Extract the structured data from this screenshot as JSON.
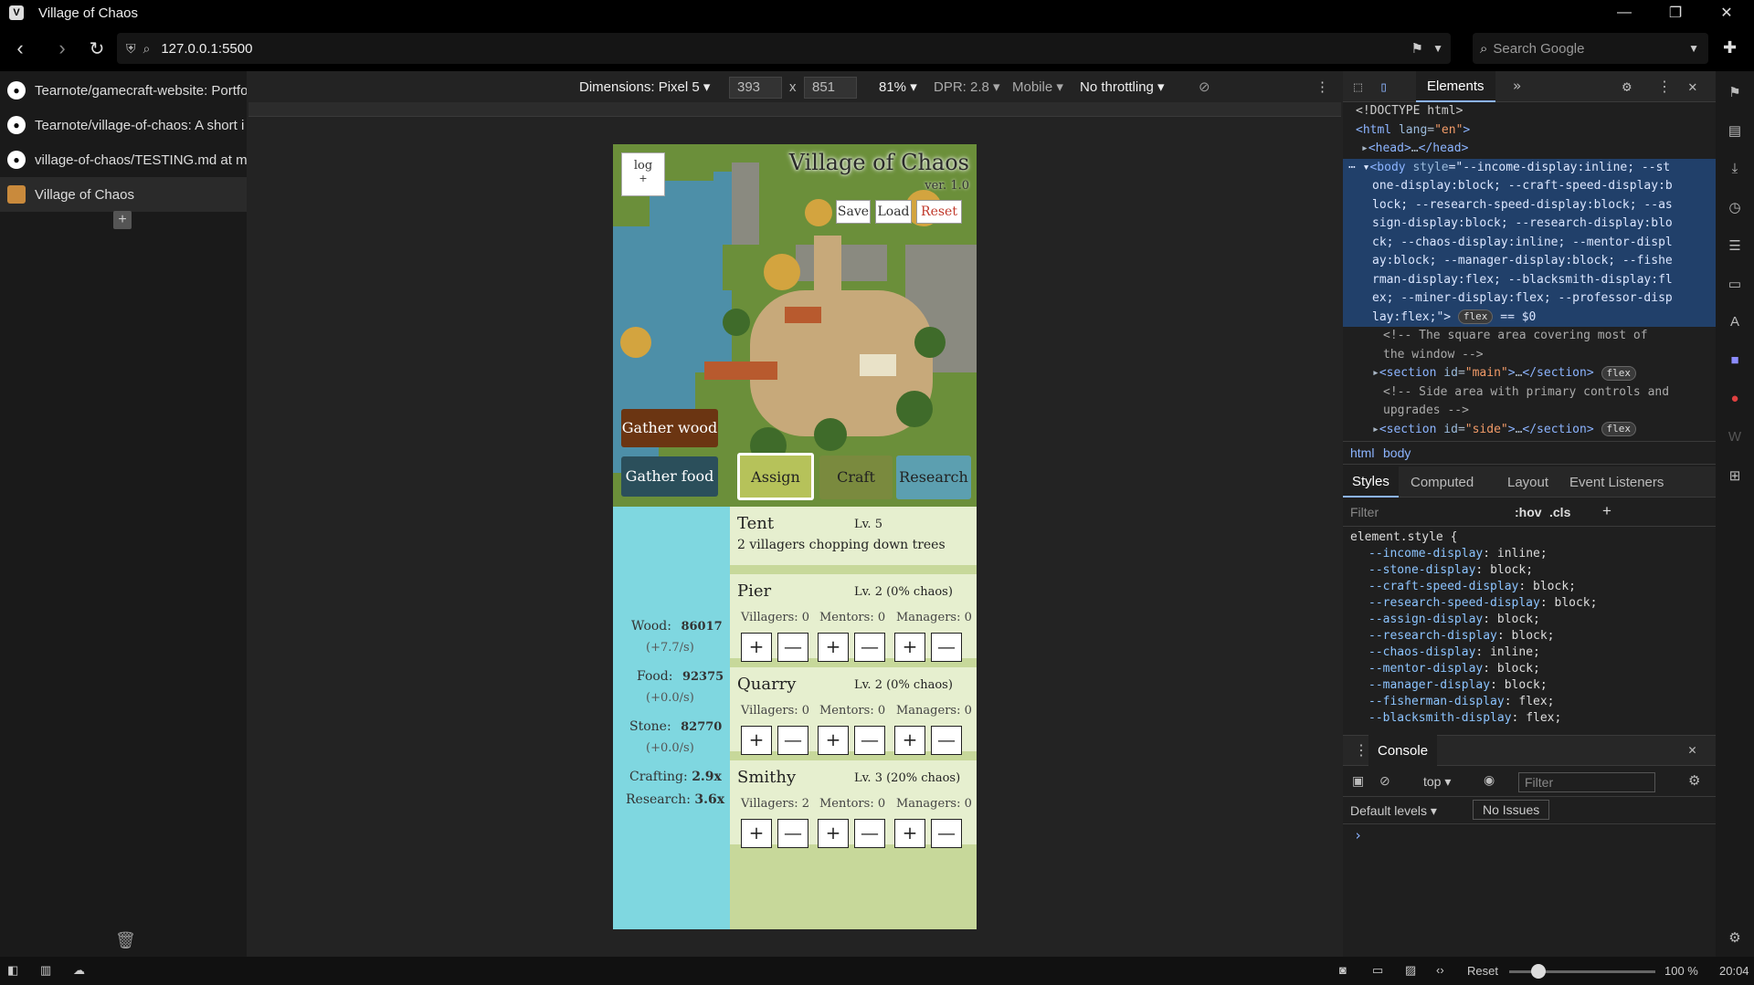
{
  "window": {
    "title": "Village of Chaos"
  },
  "nav": {
    "url": "127.0.0.1:5500",
    "search_placeholder": "Search Google"
  },
  "tabs": [
    {
      "label": "Tearnote/gamecraft-website: Portfo"
    },
    {
      "label": "Tearnote/village-of-chaos: A short i"
    },
    {
      "label": "village-of-chaos/TESTING.md at m"
    },
    {
      "label": "Village of Chaos"
    }
  ],
  "devtoolbar": {
    "dimensions": "Dimensions: Pixel 5 ▾",
    "width": "393",
    "x": "x",
    "height": "851",
    "zoom": "81% ▾",
    "dpr": "DPR: 2.8 ▾",
    "mode": "Mobile ▾",
    "throttle": "No throttling ▾"
  },
  "game": {
    "log_label": "log",
    "log_sub": "+",
    "title": "Village of Chaos",
    "version": "ver. 1.0",
    "save": "Save",
    "load": "Load",
    "reset": "Reset",
    "gather_wood": "Gather wood",
    "gather_food": "Gather food",
    "assign": "Assign",
    "craft": "Craft",
    "research": "Research"
  },
  "stats": {
    "wood_label": "Wood:",
    "wood": "86017",
    "wood_rate": "(+7.7/s)",
    "food_label": "Food:",
    "food": "92375",
    "food_rate": "(+0.0/s)",
    "stone_label": "Stone:",
    "stone": "82770",
    "stone_rate": "(+0.0/s)",
    "crafting_label": "Crafting:",
    "crafting": "2.9x",
    "research_label": "Research:",
    "research": "3.6x"
  },
  "buildings": [
    {
      "name": "Tent",
      "level": "Lv. 5",
      "desc": "2 villagers chopping down trees"
    },
    {
      "name": "Pier",
      "level": "Lv. 2 (0% chaos)",
      "villagers": "Villagers: 0",
      "mentors": "Mentors: 0",
      "managers": "Managers: 0"
    },
    {
      "name": "Quarry",
      "level": "Lv. 2 (0% chaos)",
      "villagers": "Villagers: 0",
      "mentors": "Mentors: 0",
      "managers": "Managers: 0"
    },
    {
      "name": "Smithy",
      "level": "Lv. 3 (20% chaos)",
      "villagers": "Villagers: 2",
      "mentors": "Mentors: 0",
      "managers": "Managers: 0"
    }
  ],
  "buttons": {
    "plus": "+",
    "minus": "—"
  },
  "devtools": {
    "tab_elements": "Elements",
    "crumb_html": "html",
    "crumb_body": "body",
    "styles_tabs": [
      "Styles",
      "Computed",
      "Layout",
      "Event Listeners"
    ],
    "filter_placeholder": "Filter",
    "hov": ":hov",
    "cls": ".cls",
    "element_style": "element.style {",
    "css_props": [
      {
        "p": "--income-display",
        "v": "inline;"
      },
      {
        "p": "--stone-display",
        "v": "block;"
      },
      {
        "p": "--craft-speed-display",
        "v": "block;"
      },
      {
        "p": "--research-speed-display",
        "v": "block;"
      },
      {
        "p": "--assign-display",
        "v": "block;"
      },
      {
        "p": "--research-display",
        "v": "block;"
      },
      {
        "p": "--chaos-display",
        "v": "inline;"
      },
      {
        "p": "--mentor-display",
        "v": "block;"
      },
      {
        "p": "--manager-display",
        "v": "block;"
      },
      {
        "p": "--fisherman-display",
        "v": "flex;"
      },
      {
        "p": "--blacksmith-display",
        "v": "flex;"
      }
    ],
    "console_tab": "Console",
    "console_context": "top ▾",
    "console_filter": "Filter",
    "default_levels": "Default levels ▾",
    "no_issues": "No Issues",
    "prompt": "›"
  },
  "statusbar": {
    "reset": "Reset",
    "zoom": "100 %",
    "time": "20:04"
  }
}
